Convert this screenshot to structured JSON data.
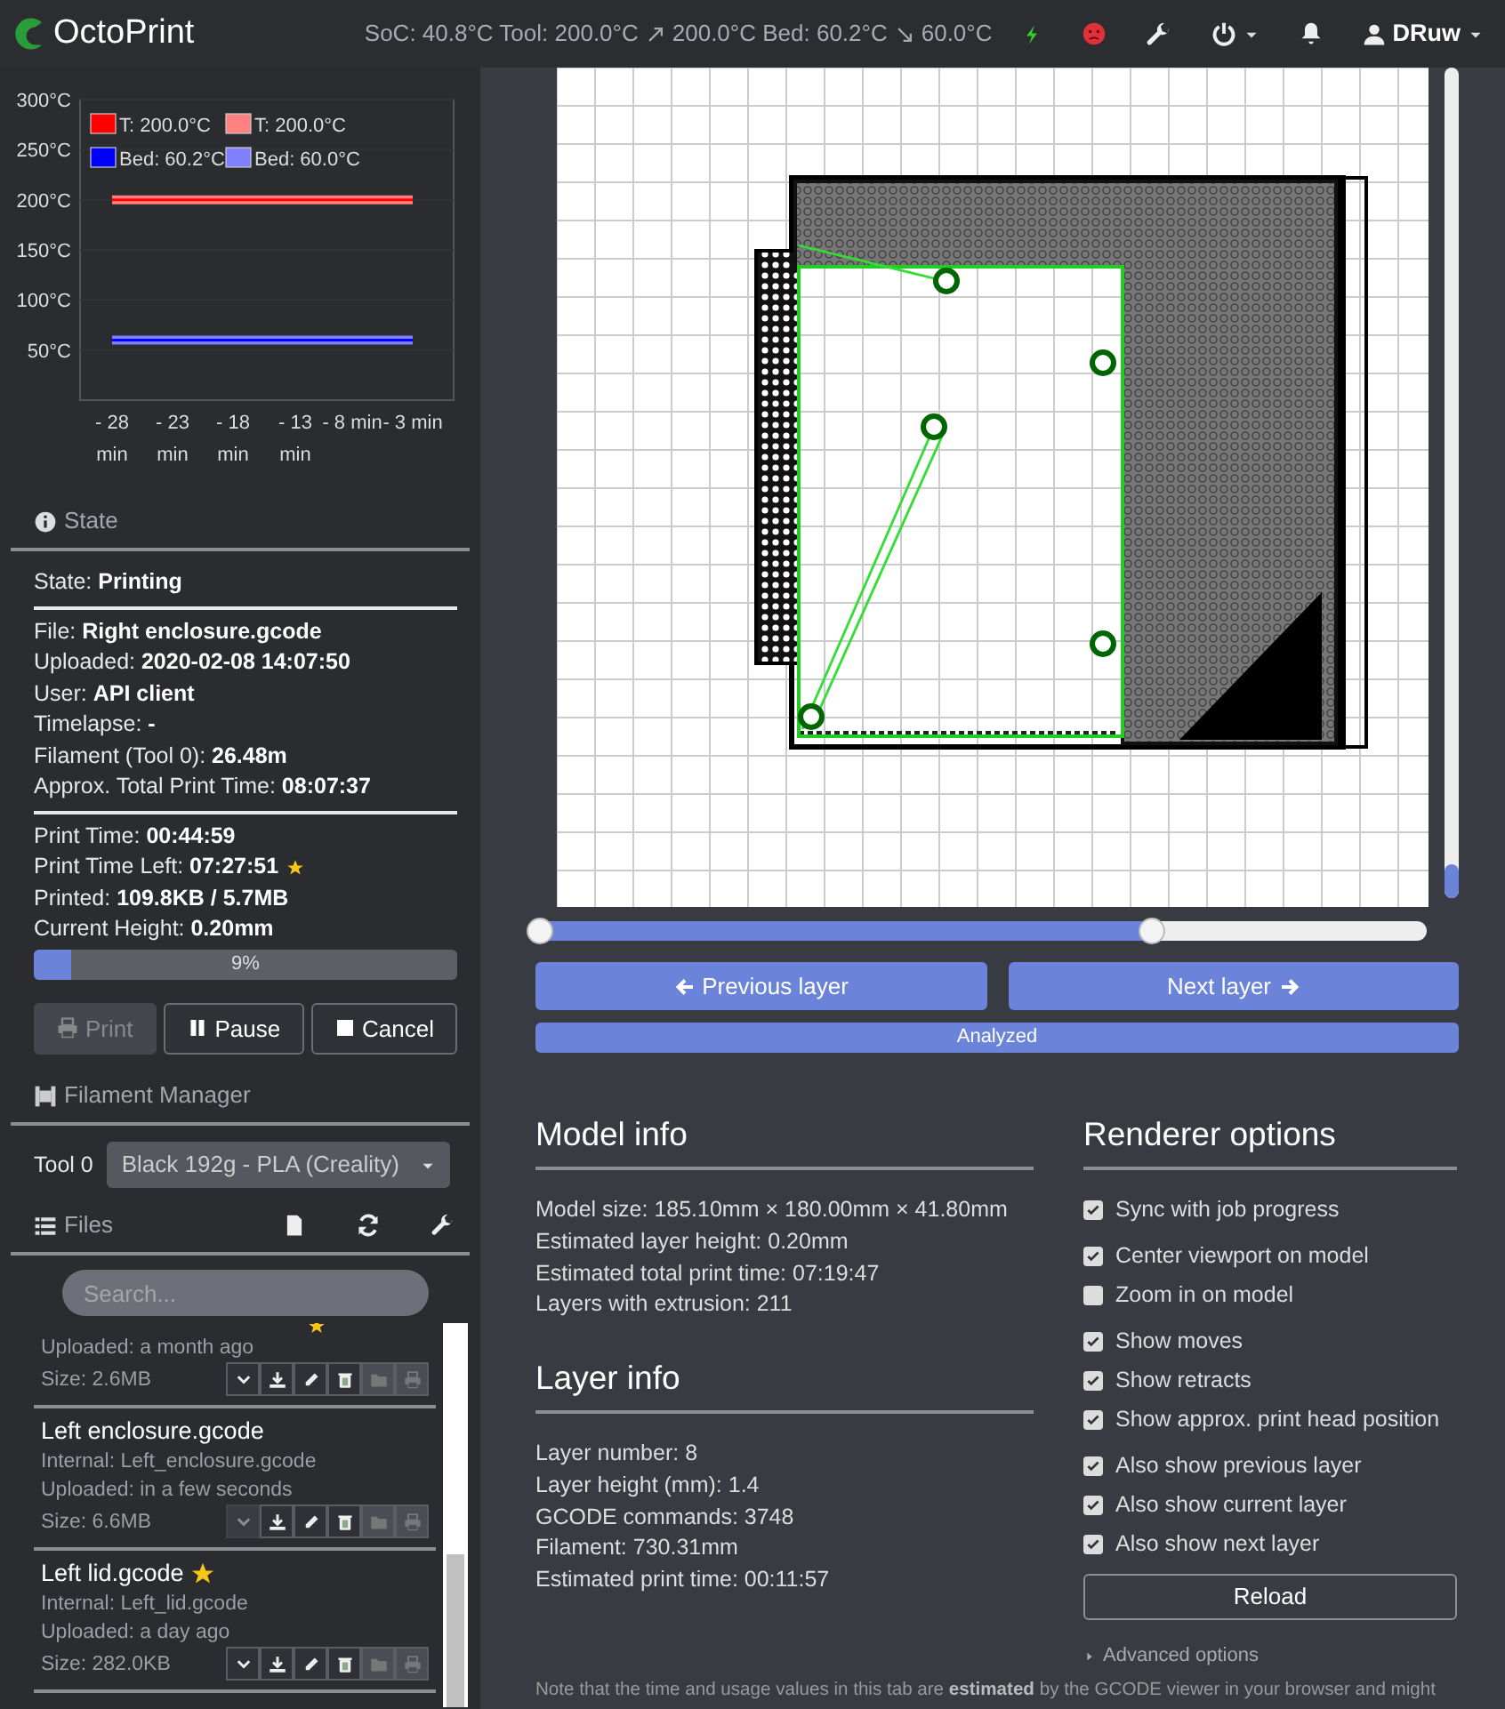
{
  "navbar": {
    "brand": "OctoPrint",
    "status": {
      "soc_tool": "SoC: 40.8°C Tool: 200.0°C",
      "tool_target_bed": "200.0°C Bed: 60.2°C",
      "bed_target": "60.0°C"
    },
    "user": "DRuw"
  },
  "temperature": {
    "chart_data": {
      "type": "line",
      "categories": [
        "- 28 min",
        "- 23 min",
        "- 18 min",
        "- 13 min",
        "- 8 min",
        "- 3 min"
      ],
      "yticks": [
        {
          "value": 50,
          "label": "50°C"
        },
        {
          "value": 100,
          "label": "100°C"
        },
        {
          "value": 150,
          "label": "150°C"
        },
        {
          "value": 200,
          "label": "200°C"
        },
        {
          "value": 250,
          "label": "250°C"
        },
        {
          "value": 300,
          "label": "300°C"
        }
      ],
      "ylim": [
        0,
        300
      ],
      "grid": true,
      "legend": true,
      "series": [
        {
          "name": "T: 200.0°C",
          "color": "#ff0000",
          "values": [
            200,
            200,
            200,
            200,
            200,
            200
          ]
        },
        {
          "name": "T: 200.0°C",
          "color": "#ff8080",
          "values": [
            200,
            200,
            200,
            200,
            200,
            200
          ]
        },
        {
          "name": "Bed: 60.2°C",
          "color": "#0000ff",
          "values": [
            60,
            60,
            60,
            60,
            60,
            60
          ]
        },
        {
          "name": "Bed: 60.0°C",
          "color": "#8080ff",
          "values": [
            60,
            60,
            60,
            60,
            60,
            60
          ]
        }
      ]
    }
  },
  "state": {
    "title": "State",
    "status": "State: **Printing**",
    "job": [
      "File: **Right enclosure.gcode**",
      "Uploaded: **2020-02-08 14:07:50**",
      "User: **API client**",
      "Timelapse: **-**",
      "Filament (Tool 0): **26.48m**",
      "Approx. Total Print Time: **08:07:37**"
    ],
    "progress_rows": [
      {
        "text": "Print Time: **00:44:59**",
        "starred": false
      },
      {
        "text": "Print Time Left: **07:27:51**",
        "starred": true
      },
      {
        "text": "Printed: **109.8KB / 5.7MB**",
        "starred": false
      },
      {
        "text": "Current Height: **0.20mm**",
        "starred": false
      }
    ],
    "progress": {
      "level": 0.09,
      "label": "9%"
    },
    "buttons": [
      {
        "kind": "print",
        "label": "Print",
        "disabled": true
      },
      {
        "kind": "pause",
        "label": "Pause",
        "disabled": false
      },
      {
        "kind": "cancel",
        "label": "Cancel",
        "disabled": false
      }
    ]
  },
  "filament_manager": {
    "title": "Filament Manager",
    "tool_label": "Tool 0",
    "spool": "Black 192g - PLA (Creality)"
  },
  "files": {
    "title": "Files",
    "search": {
      "placeholder": "Search..."
    },
    "items": [
      {
        "starred": true,
        "uploaded": "Uploaded: a month ago",
        "size": "Size: 2.6MB",
        "expand_disabled": false
      },
      {
        "name": "Left enclosure.gcode",
        "starred": false,
        "internal": "Internal: Left_enclosure.gcode",
        "uploaded": "Uploaded: in a few seconds",
        "size": "Size: 6.6MB",
        "expand_disabled": true
      },
      {
        "name": "Left lid.gcode",
        "starred": true,
        "internal": "Internal: Left_lid.gcode",
        "uploaded": "Uploaded: a day ago",
        "size": "Size: 282.0KB",
        "expand_disabled": false
      }
    ]
  },
  "viewer": {
    "layer_slider": {
      "level": 0.04
    },
    "command_range": [
      {
        "level": 0
      },
      {
        "level": 0.69
      }
    ],
    "buttons": [
      {
        "kind": "previous",
        "label": "Previous layer"
      },
      {
        "kind": "next",
        "label": "Next layer"
      }
    ],
    "analysis_status": "Analyzed"
  },
  "model_info": {
    "title": "Model info",
    "lines": [
      "Model size: 185.10mm × 180.00mm × 41.80mm",
      "Estimated layer height: 0.20mm",
      "Estimated total print time: 07:19:47",
      "Layers with extrusion: 211"
    ]
  },
  "layer_info": {
    "title": "Layer info",
    "lines": [
      "Layer number: 8",
      "Layer height (mm): 1.4",
      "GCODE commands: 3748",
      "Filament: 730.31mm",
      "Estimated print time: 00:11:57"
    ]
  },
  "renderer_options": {
    "title": "Renderer options",
    "option_groups": [
      [
        {
          "label": "Sync with job progress",
          "checked": true
        }
      ],
      [
        {
          "label": "Center viewport on model",
          "checked": true
        },
        {
          "label": "Zoom in on model",
          "checked": false
        }
      ],
      [
        {
          "label": "Show moves",
          "checked": true
        },
        {
          "label": "Show retracts",
          "checked": true
        },
        {
          "label": "Show approx. print head position",
          "checked": true
        }
      ],
      [
        {
          "label": "Also show previous layer",
          "checked": true
        },
        {
          "label": "Also show current layer",
          "checked": true
        },
        {
          "label": "Also show next layer",
          "checked": true
        }
      ]
    ],
    "reload": "Reload",
    "advanced": "Advanced options"
  },
  "note": "Note that the time and usage values in this tab are **estimated** by the GCODE viewer in your browser and might"
}
